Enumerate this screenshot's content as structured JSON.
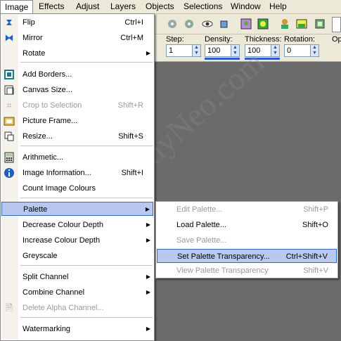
{
  "menubar": [
    "Image",
    "Effects",
    "Adjust",
    "Layers",
    "Objects",
    "Selections",
    "Window",
    "Help"
  ],
  "options": {
    "step_label": "Step:",
    "step_value": "1",
    "density_label": "Density:",
    "density_value": "100",
    "thickness_label": "Thickness:",
    "thickness_value": "100",
    "rotation_label": "Rotation:",
    "rotation_value": "0",
    "opacity_label": "Op"
  },
  "watermark": "SunnyNeo.com",
  "image_menu": {
    "flip": {
      "label": "Flip",
      "shortcut": "Ctrl+I"
    },
    "mirror": {
      "label": "Mirror",
      "shortcut": "Ctrl+M"
    },
    "rotate": {
      "label": "Rotate"
    },
    "add_borders": {
      "label": "Add Borders..."
    },
    "canvas_size": {
      "label": "Canvas Size..."
    },
    "crop_to_selection": {
      "label": "Crop to Selection",
      "shortcut": "Shift+R"
    },
    "picture_frame": {
      "label": "Picture Frame..."
    },
    "resize": {
      "label": "Resize...",
      "shortcut": "Shift+S"
    },
    "arithmetic": {
      "label": "Arithmetic..."
    },
    "image_information": {
      "label": "Image Information...",
      "shortcut": "Shift+I"
    },
    "count_image_colours": {
      "label": "Count Image Colours"
    },
    "palette": {
      "label": "Palette"
    },
    "decrease_colour_depth": {
      "label": "Decrease Colour Depth"
    },
    "increase_colour_depth": {
      "label": "Increase Colour Depth"
    },
    "greyscale": {
      "label": "Greyscale"
    },
    "split_channel": {
      "label": "Split Channel"
    },
    "combine_channel": {
      "label": "Combine Channel"
    },
    "delete_alpha_channel": {
      "label": "Delete Alpha Channel..."
    },
    "watermarking": {
      "label": "Watermarking"
    }
  },
  "palette_menu": {
    "edit_palette": {
      "label": "Edit Palette...",
      "shortcut": "Shift+P"
    },
    "load_palette": {
      "label": "Load Palette...",
      "shortcut": "Shift+O"
    },
    "save_palette": {
      "label": "Save Palette..."
    },
    "set_palette_transparency": {
      "label": "Set Palette Transparency...",
      "shortcut": "Ctrl+Shift+V"
    },
    "view_palette_transparency": {
      "label": "View Palette Transparency",
      "shortcut": "Shift+V"
    }
  },
  "colors": {
    "highlight": "#b8c8ef",
    "highlight_border": "#316ac5",
    "workspace": "#6b6b6b",
    "chrome": "#ece9d8"
  }
}
